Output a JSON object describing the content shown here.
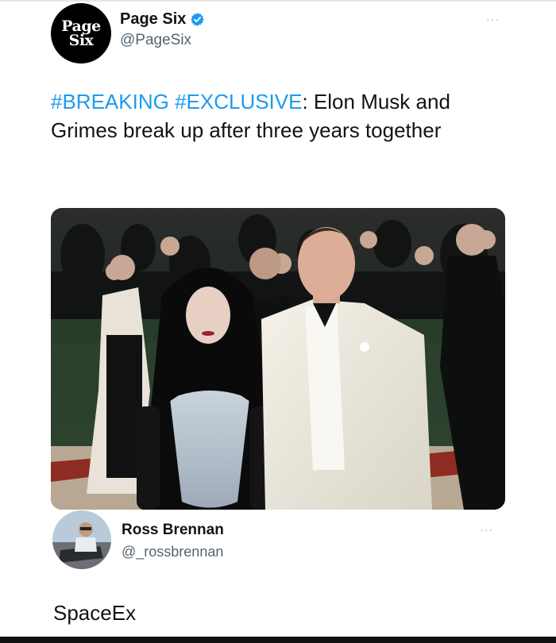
{
  "tweet": {
    "avatar_line1": "Page",
    "avatar_line2": "Six",
    "display_name": "Page Six",
    "handle": "@PageSix",
    "hashtag1": "#BREAKING",
    "hashtag2": "#EXCLUSIVE",
    "text_colon": ":",
    "text_body": " Elon Musk and Grimes break up after three years together",
    "more_icon": "···"
  },
  "reply": {
    "display_name": "Ross Brennan",
    "handle": "@_rossbrennan",
    "text": "SpaceEx",
    "more_icon": "···"
  },
  "colors": {
    "hashtag": "#1d9bf0",
    "verified": "#1d9bf0",
    "handle": "#536471"
  }
}
